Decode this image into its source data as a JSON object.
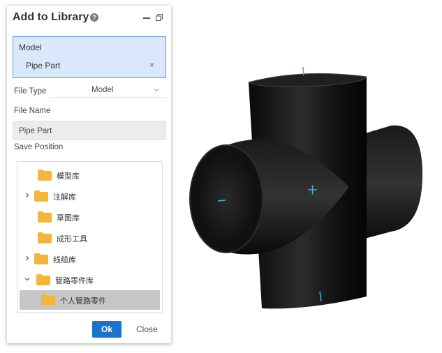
{
  "dialog": {
    "title": "Add to Library",
    "help_glyph": "?",
    "model_section": {
      "label": "Model",
      "item": "Pipe Part",
      "remove_glyph": "×"
    },
    "file_type": {
      "label": "File Type",
      "value": "Model"
    },
    "file_name": {
      "label": "File Name",
      "value": "Pipe Part"
    },
    "save_position": {
      "label": "Save Position"
    },
    "tree": [
      {
        "label": "模型库",
        "expander": "none",
        "selected": false
      },
      {
        "label": "注解库",
        "expander": "collapsed",
        "selected": false
      },
      {
        "label": "草图库",
        "expander": "none",
        "selected": false
      },
      {
        "label": "成形工具",
        "expander": "none",
        "selected": false
      },
      {
        "label": "线缆库",
        "expander": "collapsed",
        "selected": false
      },
      {
        "label": "管路零件库",
        "expander": "expanded",
        "selected": false
      },
      {
        "label": "个人管路零件",
        "expander": "none",
        "selected": true
      }
    ],
    "ok_label": "Ok",
    "close_label": "Close"
  },
  "colors": {
    "accent": "#1a73c9",
    "model_box_bg": "#d9e9fb",
    "folder": "#f2b63c",
    "selected_row": "#c6c6c6",
    "axis_marker": "#3ab7d8"
  },
  "icons": {
    "help": "help-icon",
    "minimize": "minimize-icon",
    "restore": "restore-window-icon",
    "folder": "folder-icon",
    "chevron": "chevron-icon"
  },
  "viewport": {
    "object": "pipe-cross-fitting"
  }
}
